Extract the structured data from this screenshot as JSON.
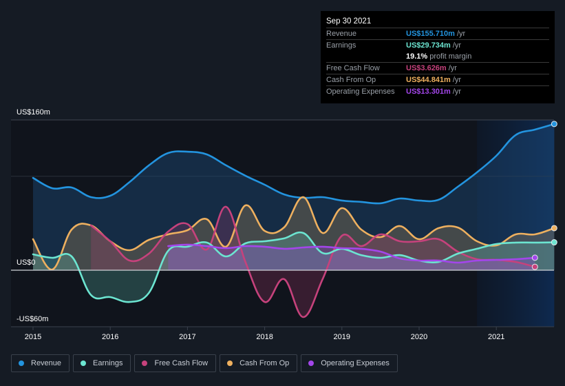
{
  "tooltip": {
    "date": "Sep 30 2021",
    "rows": [
      {
        "label": "Revenue",
        "value": "US$155.710m",
        "unit": "/yr",
        "color": "#2394df"
      },
      {
        "label": "Earnings",
        "value": "US$29.734m",
        "unit": "/yr",
        "color": "#6ce5d1"
      },
      {
        "label": "",
        "value": "19.1%",
        "unit": "profit margin",
        "color": "#ffffff"
      },
      {
        "label": "Free Cash Flow",
        "value": "US$3.626m",
        "unit": "/yr",
        "color": "#c6427c"
      },
      {
        "label": "Cash From Op",
        "value": "US$44.841m",
        "unit": "/yr",
        "color": "#eeb05f"
      },
      {
        "label": "Operating Expenses",
        "value": "US$13.301m",
        "unit": "/yr",
        "color": "#a346ea"
      }
    ]
  },
  "legend": [
    {
      "label": "Revenue",
      "color": "#2394df"
    },
    {
      "label": "Earnings",
      "color": "#6ce5d1"
    },
    {
      "label": "Free Cash Flow",
      "color": "#c6427c"
    },
    {
      "label": "Cash From Op",
      "color": "#eeb05f"
    },
    {
      "label": "Operating Expenses",
      "color": "#a346ea"
    }
  ],
  "chart_data": {
    "type": "area",
    "title": "",
    "xlabel": "",
    "ylabel": "",
    "ylim": [
      -60,
      160
    ],
    "xlim": [
      2014.7,
      2021.75
    ],
    "y_tick_labels": [
      {
        "value": 160,
        "label": "US$160m"
      },
      {
        "value": 0,
        "label": "US$0"
      },
      {
        "value": -60,
        "label": "-US$60m"
      }
    ],
    "gridlines": [
      160,
      100
    ],
    "x_ticks": [
      2015,
      2016,
      2017,
      2018,
      2019,
      2020,
      2021
    ],
    "x_tick_labels": [
      "2015",
      "2016",
      "2017",
      "2018",
      "2019",
      "2020",
      "2021"
    ],
    "highlight_range": [
      2020.75,
      2021.75
    ],
    "legend_position": "bottom",
    "series": [
      {
        "name": "Revenue",
        "color": "#2394df",
        "x_start": 2015.0,
        "x_step": 0.25,
        "values": [
          98.3,
          87.3,
          88.1,
          77.8,
          79.3,
          93.9,
          111.6,
          124.8,
          126.2,
          123.3,
          111.6,
          100.6,
          91.0,
          80.7,
          77.1,
          77.8,
          74.2,
          72.7,
          71.3,
          76.3,
          74.2,
          74.9,
          88.8,
          104.2,
          121.8,
          143.9,
          149.7,
          155.7
        ]
      },
      {
        "name": "Earnings",
        "color": "#6ce5d1",
        "x_start": 2015.0,
        "x_step": 0.25,
        "values": [
          16.9,
          13.2,
          14.7,
          -26.4,
          -28.6,
          -33.8,
          -24.2,
          20.6,
          25.0,
          29.4,
          14.7,
          28.6,
          30.8,
          33.8,
          39.6,
          18.3,
          22.8,
          16.1,
          13.2,
          16.1,
          10.3,
          8.8,
          17.6,
          22.8,
          27.9,
          29.4,
          29.4,
          29.7
        ]
      },
      {
        "name": "Free Cash Flow",
        "color": "#c6427c",
        "x_start": 2015.75,
        "x_step": 0.25,
        "values": [
          47.7,
          30.8,
          10.3,
          17.6,
          41.1,
          49.2,
          22.0,
          67.5,
          8.8,
          -33.8,
          -9.5,
          -49.9,
          -9.5,
          36.7,
          25.7,
          38.2,
          30.8,
          30.8,
          33.0,
          19.8,
          11.7,
          11.0,
          8.8,
          3.6
        ]
      },
      {
        "name": "Cash From Op",
        "color": "#eeb05f",
        "x_start": 2015.0,
        "x_step": 0.25,
        "values": [
          33.0,
          0.7,
          43.3,
          47.7,
          30.8,
          21.3,
          32.3,
          38.2,
          42.6,
          54.3,
          25.0,
          69.0,
          41.8,
          45.5,
          77.8,
          39.6,
          66.1,
          43.3,
          35.2,
          47.0,
          33.0,
          44.8,
          45.5,
          30.8,
          26.4,
          38.2,
          38.2,
          44.8
        ]
      },
      {
        "name": "Operating Expenses",
        "color": "#a346ea",
        "x_start": 2016.75,
        "x_step": 0.25,
        "values": [
          25.7,
          27.2,
          25.7,
          23.5,
          25.7,
          25.0,
          22.8,
          24.2,
          25.0,
          23.5,
          22.8,
          19.8,
          12.5,
          10.3,
          10.3,
          8.1,
          10.3,
          11.0,
          11.7,
          13.3
        ]
      }
    ]
  }
}
